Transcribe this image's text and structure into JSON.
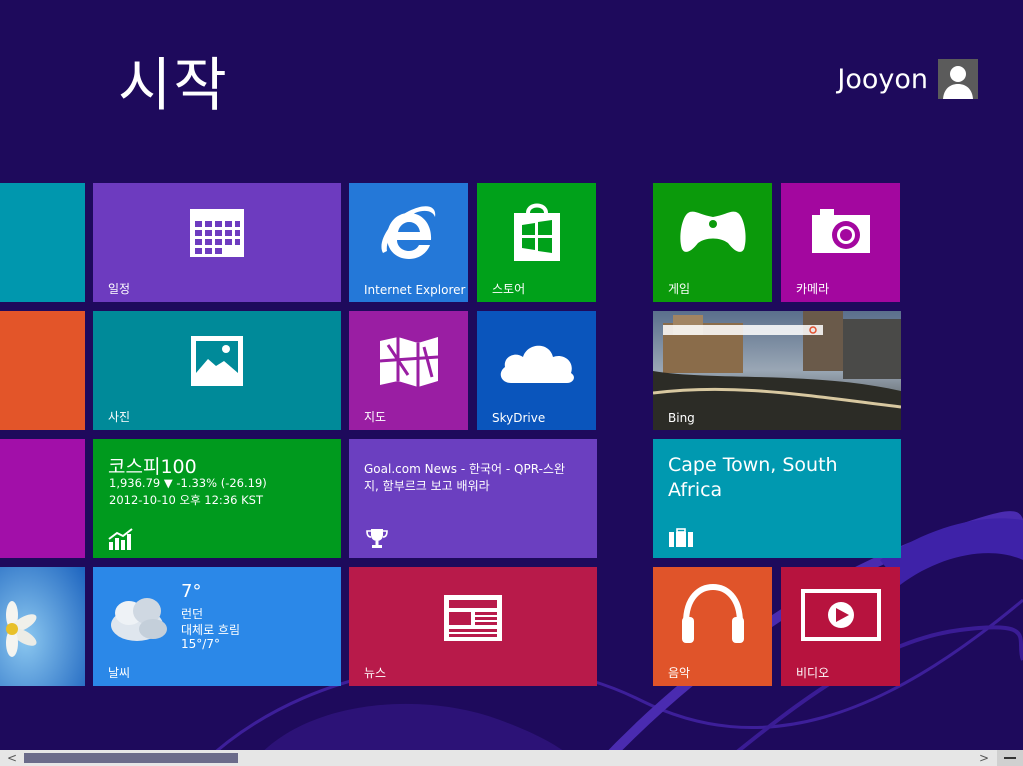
{
  "header": {
    "title": "시작",
    "user_name": "Jooyon"
  },
  "tiles": {
    "calendar": {
      "label": "일정",
      "color": "#6d3bbf"
    },
    "photos": {
      "label": "사진",
      "color": "#008a99"
    },
    "finance": {
      "title": "코스피100",
      "line1": "1,936.79  ▼ -1.33% (-26.19)",
      "line2": "2012-10-10 오후 12:36 KST",
      "color": "#009a1e"
    },
    "weather": {
      "temp": "7°",
      "city": "런던",
      "condition": "대체로 흐림",
      "range": "15°/7°",
      "label": "날씨",
      "color": "#2b88e8"
    },
    "ie": {
      "label": "Internet Explorer",
      "color": "#2478d8"
    },
    "store": {
      "label": "스토어",
      "color": "#00a11a"
    },
    "maps": {
      "label": "지도",
      "color": "#9a1ea3"
    },
    "skydrive": {
      "label": "SkyDrive",
      "color": "#0a55bc"
    },
    "sports": {
      "headline": "Goal.com News - 한국어 - QPR-스완지, 함부르크 보고 배워라",
      "color": "#6b3fc0"
    },
    "news": {
      "label": "뉴스",
      "color": "#b81a4a"
    },
    "games": {
      "label": "게임",
      "color": "#0b9a0b"
    },
    "camera": {
      "label": "카메라",
      "color": "#a3079f"
    },
    "bing": {
      "label": "Bing"
    },
    "travel": {
      "text": "Cape Town, South Africa",
      "color": "#0099b0"
    },
    "music": {
      "label": "음악",
      "color": "#e0542a"
    },
    "video": {
      "label": "비디오",
      "color": "#b7133e"
    },
    "partial_colors": [
      "#0097ae",
      "#e35529",
      "#a20fa9",
      "#2b7fd6"
    ]
  },
  "scrollbar": {
    "left_arrow": "<",
    "right_arrow": ">",
    "position": 0.22
  }
}
